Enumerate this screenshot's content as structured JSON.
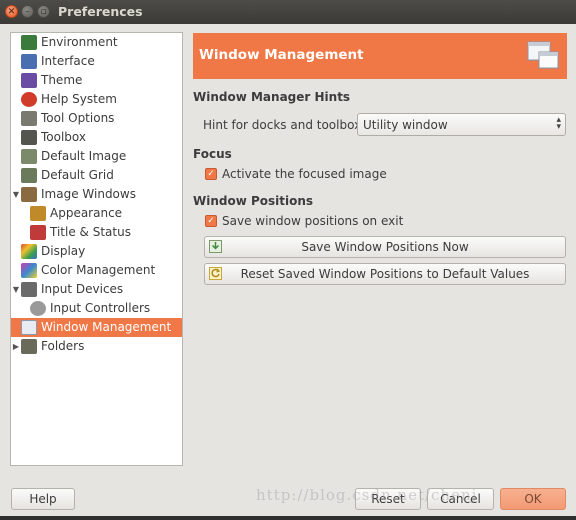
{
  "window": {
    "title": "Preferences"
  },
  "sidebar": {
    "items": [
      {
        "label": "Environment",
        "icon": "environment-icon",
        "color": "#3a7a3a",
        "selected": false
      },
      {
        "label": "Interface",
        "icon": "interface-icon",
        "color": "#4a6fb0",
        "selected": false
      },
      {
        "label": "Theme",
        "icon": "theme-icon",
        "color": "#6a4da3",
        "selected": false
      },
      {
        "label": "Help System",
        "icon": "help-system-icon",
        "color": "#d03b2a",
        "selected": false
      },
      {
        "label": "Tool Options",
        "icon": "tool-options-icon",
        "color": "#7a7a70",
        "selected": false
      },
      {
        "label": "Toolbox",
        "icon": "toolbox-icon",
        "color": "#555550",
        "selected": false
      },
      {
        "label": "Default Image",
        "icon": "default-image-icon",
        "color": "#7a8a6a",
        "selected": false
      },
      {
        "label": "Default Grid",
        "icon": "default-grid-icon",
        "color": "#6a7a5a",
        "selected": false
      },
      {
        "label": "Image Windows",
        "icon": "image-windows-icon",
        "color": "#8a6a40",
        "selected": false
      },
      {
        "label": "Appearance",
        "icon": "appearance-icon",
        "color": "#c0892a",
        "selected": false
      },
      {
        "label": "Title & Status",
        "icon": "title-status-icon",
        "color": "#c03a3a",
        "selected": false
      },
      {
        "label": "Display",
        "icon": "display-icon",
        "color": "#3a8ac0",
        "selected": false
      },
      {
        "label": "Color Management",
        "icon": "color-management-icon",
        "color": "#c04ab0",
        "selected": false
      },
      {
        "label": "Input Devices",
        "icon": "input-devices-icon",
        "color": "#6a6a6a",
        "selected": false
      },
      {
        "label": "Input Controllers",
        "icon": "input-controllers-icon",
        "color": "#8a8a8a",
        "selected": false
      },
      {
        "label": "Window Management",
        "icon": "window-management-icon",
        "color": "#7a8aa0",
        "selected": true
      },
      {
        "label": "Folders",
        "icon": "folders-icon",
        "color": "#6a6a5a",
        "selected": false
      }
    ]
  },
  "panel": {
    "title": "Window Management",
    "hints_section": "Window Manager Hints",
    "hint_label": "Hint for docks and toolbox:",
    "hint_value": "Utility window",
    "focus_section": "Focus",
    "activate_focused_label": "Activate the focused image",
    "activate_focused_checked": true,
    "positions_section": "Window Positions",
    "save_on_exit_label": "Save window positions on exit",
    "save_on_exit_checked": true,
    "save_now_label": "Save Window Positions Now",
    "reset_label": "Reset Saved Window Positions to Default Values"
  },
  "footer": {
    "help": "Help",
    "reset": "Reset",
    "cancel": "Cancel",
    "ok": "OK"
  },
  "watermark": "http://blog.csdn.net/chenj"
}
